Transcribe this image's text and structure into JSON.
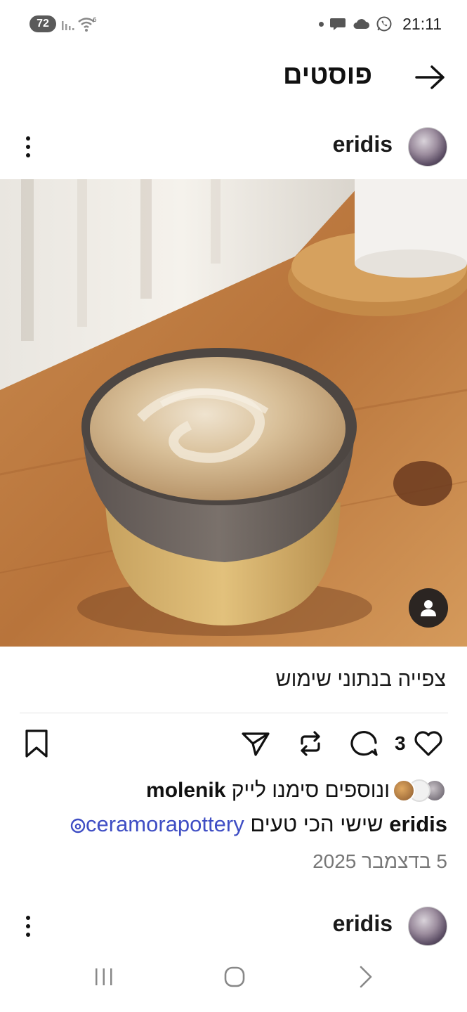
{
  "status": {
    "battery": "72",
    "wifi_badge": "6",
    "time": "21:11"
  },
  "header": {
    "title": "פוסטים"
  },
  "post": {
    "username": "eridis",
    "image_alt": "coffee-cup",
    "caption_top": "צפייה בנתוני שימוש",
    "like_count": "3",
    "likes_text_prefix": "",
    "likes_user": "molenik",
    "likes_text_suffix": "ונוספים סימנו לייק",
    "caption_user": "eridis",
    "caption_text": "שישי הכי טעים",
    "caption_mention": "ceramorapottery",
    "date": "5 בדצמבר 2025"
  },
  "next_post": {
    "username": "eridis"
  },
  "colors": {
    "mention": "#3f4ec4",
    "text": "#111111",
    "muted": "#777777"
  }
}
